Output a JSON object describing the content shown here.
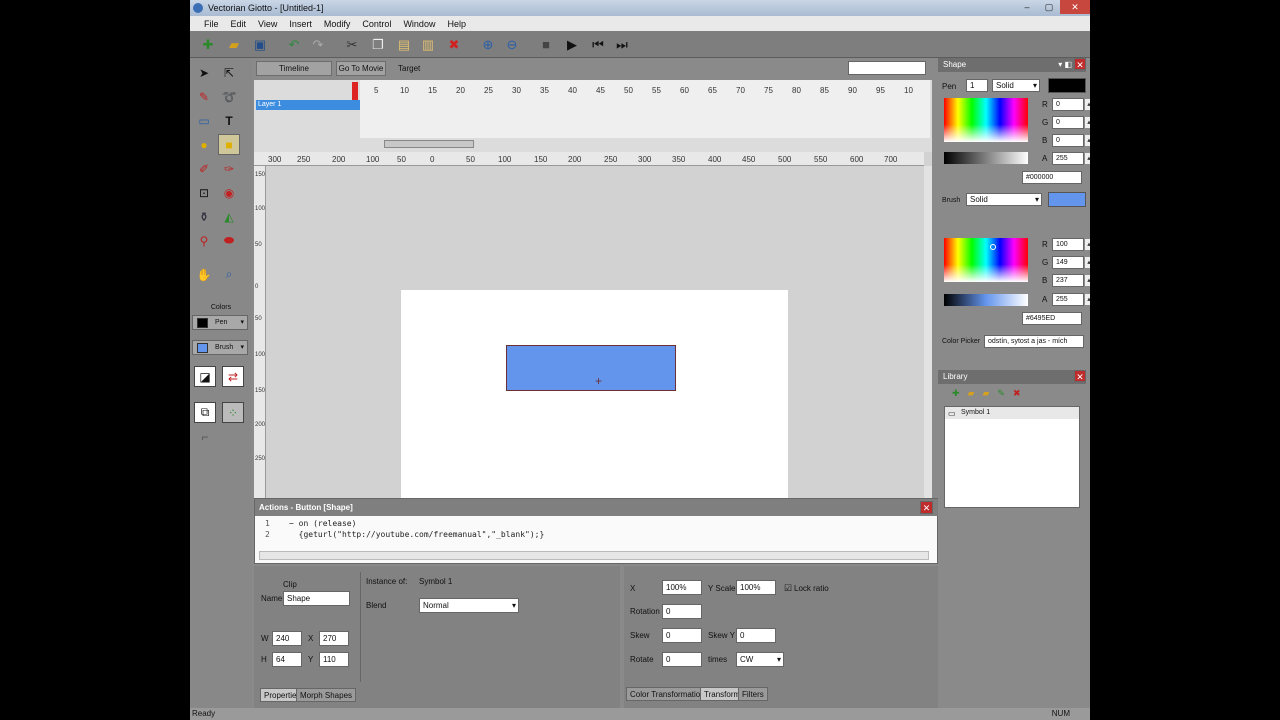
{
  "window": {
    "title": "Vectorian Giotto - [Untitled-1]"
  },
  "menu": [
    "File",
    "Edit",
    "View",
    "Insert",
    "Modify",
    "Control",
    "Window",
    "Help"
  ],
  "timeline": {
    "tab_timeline": "Timeline",
    "tab_goto": "Go To Movie",
    "target_label": "Target",
    "layer_name": "Layer 1",
    "frame_numbers": [
      "5",
      "10",
      "15",
      "20",
      "25",
      "30",
      "35",
      "40",
      "45",
      "50",
      "55",
      "60",
      "65",
      "70",
      "75",
      "80",
      "85",
      "90",
      "95",
      "10"
    ]
  },
  "rulers": {
    "h": [
      "300",
      "250",
      "200",
      "150",
      "100",
      "50",
      "0",
      "50",
      "100",
      "150",
      "200",
      "250",
      "300",
      "350",
      "400",
      "450",
      "500",
      "550",
      "600",
      "650",
      "700"
    ],
    "v": [
      "150",
      "100",
      "50",
      "0",
      "50",
      "100",
      "150",
      "200",
      "250"
    ]
  },
  "toolbox": {
    "colors_label": "Colors",
    "pen_label": "Pen",
    "brush_label": "Brush",
    "pen_color": "#000000",
    "brush_color": "#6495ED"
  },
  "actions": {
    "title": "Actions - Button [Shape]",
    "lines": [
      {
        "num": "1",
        "text": "− on (release)"
      },
      {
        "num": "2",
        "text": "  {geturl(\"http://youtube.com/freemanual\",\"_blank\");}"
      }
    ]
  },
  "properties": {
    "clip_label": "Clip",
    "name_label": "Name",
    "name_value": "Shape",
    "instance_label": "Instance of:",
    "instance_value": "Symbol 1",
    "blend_label": "Blend",
    "blend_value": "Normal",
    "w_label": "W",
    "w_value": "240",
    "x_label": "X",
    "x_value": "270",
    "h_label": "H",
    "h_value": "64",
    "y_label": "Y",
    "y_value": "110",
    "tab_properties": "Properties",
    "tab_morph": "Morph Shapes"
  },
  "transform": {
    "x_label": "X",
    "x_scale": "100%",
    "yscale_label": "Y Scale",
    "y_scale": "100%",
    "lock_label": "Lock ratio",
    "rotation_label": "Rotation",
    "rotation": "0",
    "skew_label": "Skew",
    "skew": "0",
    "skewy_label": "Skew Y",
    "skewy": "0",
    "rotate_label": "Rotate",
    "rotate": "0",
    "times_label": "times",
    "direction": "CW",
    "tab_color": "Color Transformation",
    "tab_transform": "Transform",
    "tab_filters": "Filters"
  },
  "shape_panel": {
    "title": "Shape",
    "pen_label": "Pen",
    "pen_width": "1",
    "pen_style": "Solid",
    "pen": {
      "r": "0",
      "g": "0",
      "b": "0",
      "a": "255",
      "hex": "#000000"
    },
    "brush_label": "Brush",
    "brush_style": "Solid",
    "brush": {
      "r": "100",
      "g": "149",
      "b": "237",
      "a": "255",
      "hex": "#6495ED"
    },
    "picker_label": "Color Picker",
    "picker_value": "odstín, sytost a jas - mích"
  },
  "library": {
    "title": "Library",
    "items": [
      "Symbol 1"
    ]
  },
  "status": {
    "left": "Ready",
    "right": "NUM"
  }
}
